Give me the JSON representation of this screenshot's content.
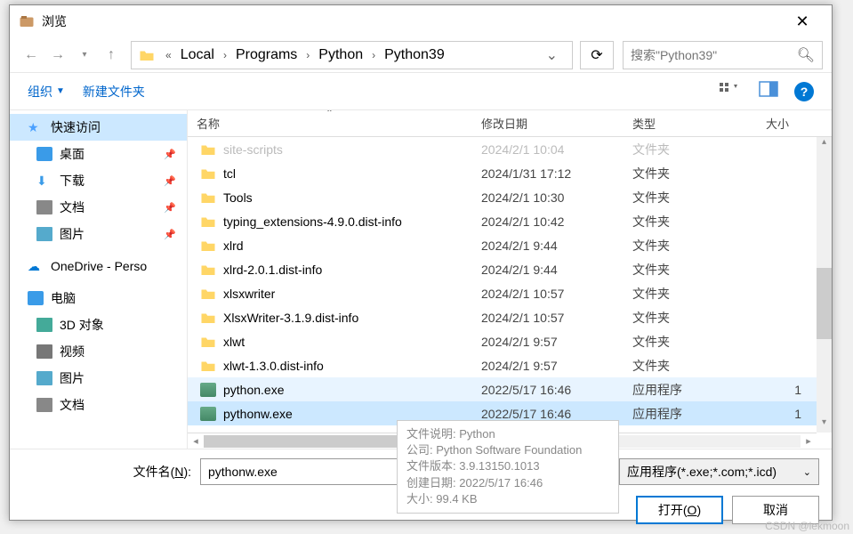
{
  "window": {
    "title": "浏览"
  },
  "breadcrumb": {
    "prefix": "«",
    "items": [
      "Local",
      "Programs",
      "Python",
      "Python39"
    ]
  },
  "search": {
    "placeholder": "搜索\"Python39\""
  },
  "toolbar": {
    "organize": "组织",
    "new_folder": "新建文件夹"
  },
  "sidebar": {
    "quick_access": "快速访问",
    "desktop": "桌面",
    "downloads": "下载",
    "documents": "文档",
    "pictures": "图片",
    "onedrive": "OneDrive - Perso",
    "this_pc": "电脑",
    "objects_3d": "3D 对象",
    "videos": "视频",
    "pictures2": "图片",
    "documents2": "文档"
  },
  "columns": {
    "name": "名称",
    "modified": "修改日期",
    "type": "类型",
    "size": "大小"
  },
  "files": [
    {
      "name": "site-scripts",
      "date": "2024/2/1 10:04",
      "type": "文件夹",
      "kind": "folder",
      "cut": true
    },
    {
      "name": "tcl",
      "date": "2024/1/31 17:12",
      "type": "文件夹",
      "kind": "folder"
    },
    {
      "name": "Tools",
      "date": "2024/2/1 10:30",
      "type": "文件夹",
      "kind": "folder"
    },
    {
      "name": "typing_extensions-4.9.0.dist-info",
      "date": "2024/2/1 10:42",
      "type": "文件夹",
      "kind": "folder"
    },
    {
      "name": "xlrd",
      "date": "2024/2/1 9:44",
      "type": "文件夹",
      "kind": "folder"
    },
    {
      "name": "xlrd-2.0.1.dist-info",
      "date": "2024/2/1 9:44",
      "type": "文件夹",
      "kind": "folder"
    },
    {
      "name": "xlsxwriter",
      "date": "2024/2/1 10:57",
      "type": "文件夹",
      "kind": "folder"
    },
    {
      "name": "XlsxWriter-3.1.9.dist-info",
      "date": "2024/2/1 10:57",
      "type": "文件夹",
      "kind": "folder"
    },
    {
      "name": "xlwt",
      "date": "2024/2/1 9:57",
      "type": "文件夹",
      "kind": "folder"
    },
    {
      "name": "xlwt-1.3.0.dist-info",
      "date": "2024/2/1 9:57",
      "type": "文件夹",
      "kind": "folder"
    },
    {
      "name": "python.exe",
      "date": "2022/5/17 16:46",
      "type": "应用程序",
      "kind": "exe",
      "size": "1",
      "hover": true
    },
    {
      "name": "pythonw.exe",
      "date": "2022/5/17 16:46",
      "type": "应用程序",
      "kind": "exe",
      "size": "1",
      "selected": true
    }
  ],
  "tooltip": {
    "desc_label": "文件说明:",
    "desc_value": "Python",
    "company_label": "公司:",
    "company_value": "Python Software Foundation",
    "version_label": "文件版本:",
    "version_value": "3.9.13150.1013",
    "created_label": "创建日期:",
    "created_value": "2022/5/17 16:46",
    "size_label": "大小:",
    "size_value": "99.4 KB"
  },
  "bottom": {
    "filename_label": "文件名(",
    "filename_label_u": "N",
    "filename_label_after": "):",
    "filename_value": "pythonw.exe",
    "filetype": "应用程序(*.exe;*.com;*.icd)",
    "open_label": "打开(",
    "open_label_u": "O",
    "open_label_after": ")",
    "cancel_label": "取消"
  },
  "watermark": "CSDN @lekmoon"
}
